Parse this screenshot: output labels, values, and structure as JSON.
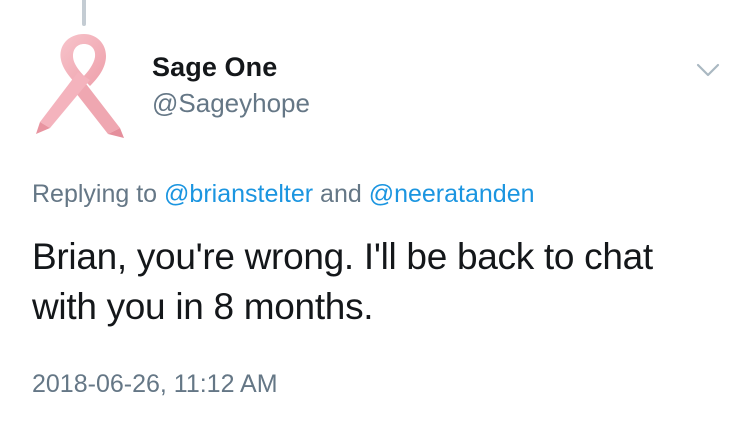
{
  "tweet": {
    "author": {
      "display_name": "Sage One",
      "handle": "@Sageyhope",
      "avatar_icon": "pink-ribbon-icon"
    },
    "menu_icon": "chevron-down-icon",
    "reply_context": {
      "prefix": "Replying to",
      "mention_1": "@brianstelter",
      "conjunction": "and",
      "mention_2": "@neeratanden"
    },
    "text": "Brian, you're wrong. I'll be back to chat with you in 8 months.",
    "timestamp": "2018-06-26, 11:12 AM"
  },
  "colors": {
    "text_primary": "#14171a",
    "text_secondary": "#657786",
    "link": "#1b95e0",
    "thread_line": "#c4ccd3",
    "ribbon": "#f4b3bd"
  }
}
